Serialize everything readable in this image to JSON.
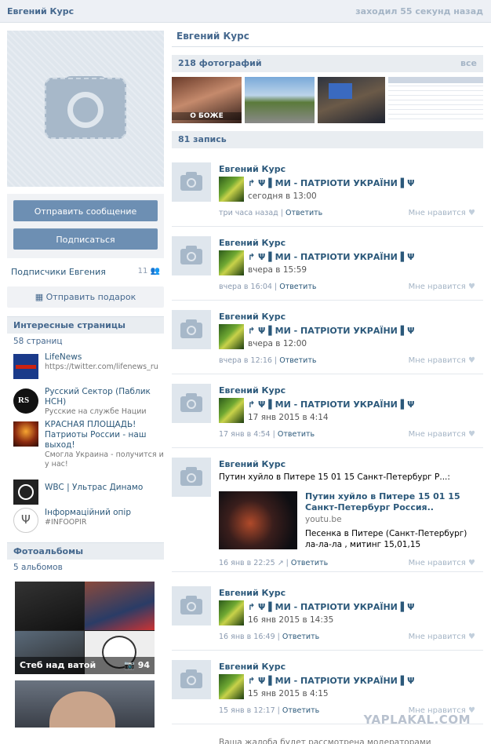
{
  "header": {
    "name": "Евгений Курс",
    "online": "заходил 55 секунд назад"
  },
  "left": {
    "send_message": "Отправить сообщение",
    "subscribe": "Подписаться",
    "subscribers_label": "Подписчики Евгения",
    "subscribers_count": "11",
    "gift": "Отправить подарок",
    "interesting_title": "Интересные страницы",
    "interesting_count": "58 страниц",
    "pages": [
      {
        "title": "LifeNews",
        "sub": "https://twitter.com/lifenews_ru"
      },
      {
        "title": "Русский Сектор (Паблик НСН)",
        "sub": "Русские на службе Нации"
      },
      {
        "title": "КРАСНАЯ ПЛОЩАДЬ! Патриоты России - наш выход!",
        "sub": "Смогла Украина - получится и у нас!"
      },
      {
        "title": "WBC | Ультрас Динамо",
        "sub": ""
      },
      {
        "title": "Інформаційний опір",
        "sub": "#INFOOPIR"
      }
    ],
    "albums_title": "Фотоальбомы",
    "albums_count": "5 альбомов",
    "album_caption": "Стеб над ватой",
    "album_count": "94"
  },
  "main": {
    "page_name": "Евгений Курс",
    "photos_title": "218 фотографий",
    "photos_all": "все",
    "photo1_caption": "О БОЖЕ",
    "posts_title": "81 запись",
    "posts": [
      {
        "author": "Евгений Курс",
        "repost_title": "Ψ ▌МИ - ПАТРІОТИ УКРАЇНИ ▌Ψ",
        "repost_date": "сегодня в 13:00",
        "time": "три часа назад",
        "reply": "Ответить",
        "like": "Мне нравится"
      },
      {
        "author": "Евгений Курс",
        "repost_title": "Ψ ▌МИ - ПАТРІОТИ УКРАЇНИ ▌Ψ",
        "repost_date": "вчера в 15:59",
        "time": "вчера в 16:04",
        "reply": "Ответить",
        "like": "Мне нравится"
      },
      {
        "author": "Евгений Курс",
        "repost_title": "Ψ ▌МИ - ПАТРІОТИ УКРАЇНИ ▌Ψ",
        "repost_date": "вчера в 12:00",
        "time": "вчера в 12:16",
        "reply": "Ответить",
        "like": "Мне нравится"
      },
      {
        "author": "Евгений Курс",
        "repost_title": "Ψ ▌МИ - ПАТРІОТИ УКРАЇНИ ▌Ψ",
        "repost_date": "17 янв 2015 в 4:14",
        "time": "17 янв в 4:54",
        "reply": "Ответить",
        "like": "Мне нравится"
      },
      {
        "author": "Евгений Курс",
        "text": "Путин хуйло в Питере 15 01 15 Санкт-Петербург Р...:",
        "video_title": "Путин хуйло в Питере 15 01 15 Санкт-Петербург Россия..",
        "video_src": "youtu.be",
        "video_desc": "Песенка в Питере (Санкт-Петербург) ла-ла-ла , митинг 15,01,15",
        "time": "16 янв в 22:25",
        "reply": "Ответить",
        "like": "Мне нравится"
      },
      {
        "author": "Евгений Курс",
        "repost_title": "Ψ ▌МИ - ПАТРІОТИ УКРАЇНИ ▌Ψ",
        "repost_date": "16 янв 2015 в 14:35",
        "time": "16 янв в 16:49",
        "reply": "Ответить",
        "like": "Мне нравится"
      },
      {
        "author": "Евгений Курс",
        "repost_title": "Ψ ▌МИ - ПАТРІОТИ УКРАЇНИ ▌Ψ",
        "repost_date": "15 янв 2015 в 4:15",
        "time": "15 янв в 12:17",
        "reply": "Ответить",
        "like": "Мне нравится"
      }
    ],
    "cutoff_text": "Ваша жалоба будет рассмотрена модераторами"
  },
  "watermark": "YAPLAKAL.COM"
}
